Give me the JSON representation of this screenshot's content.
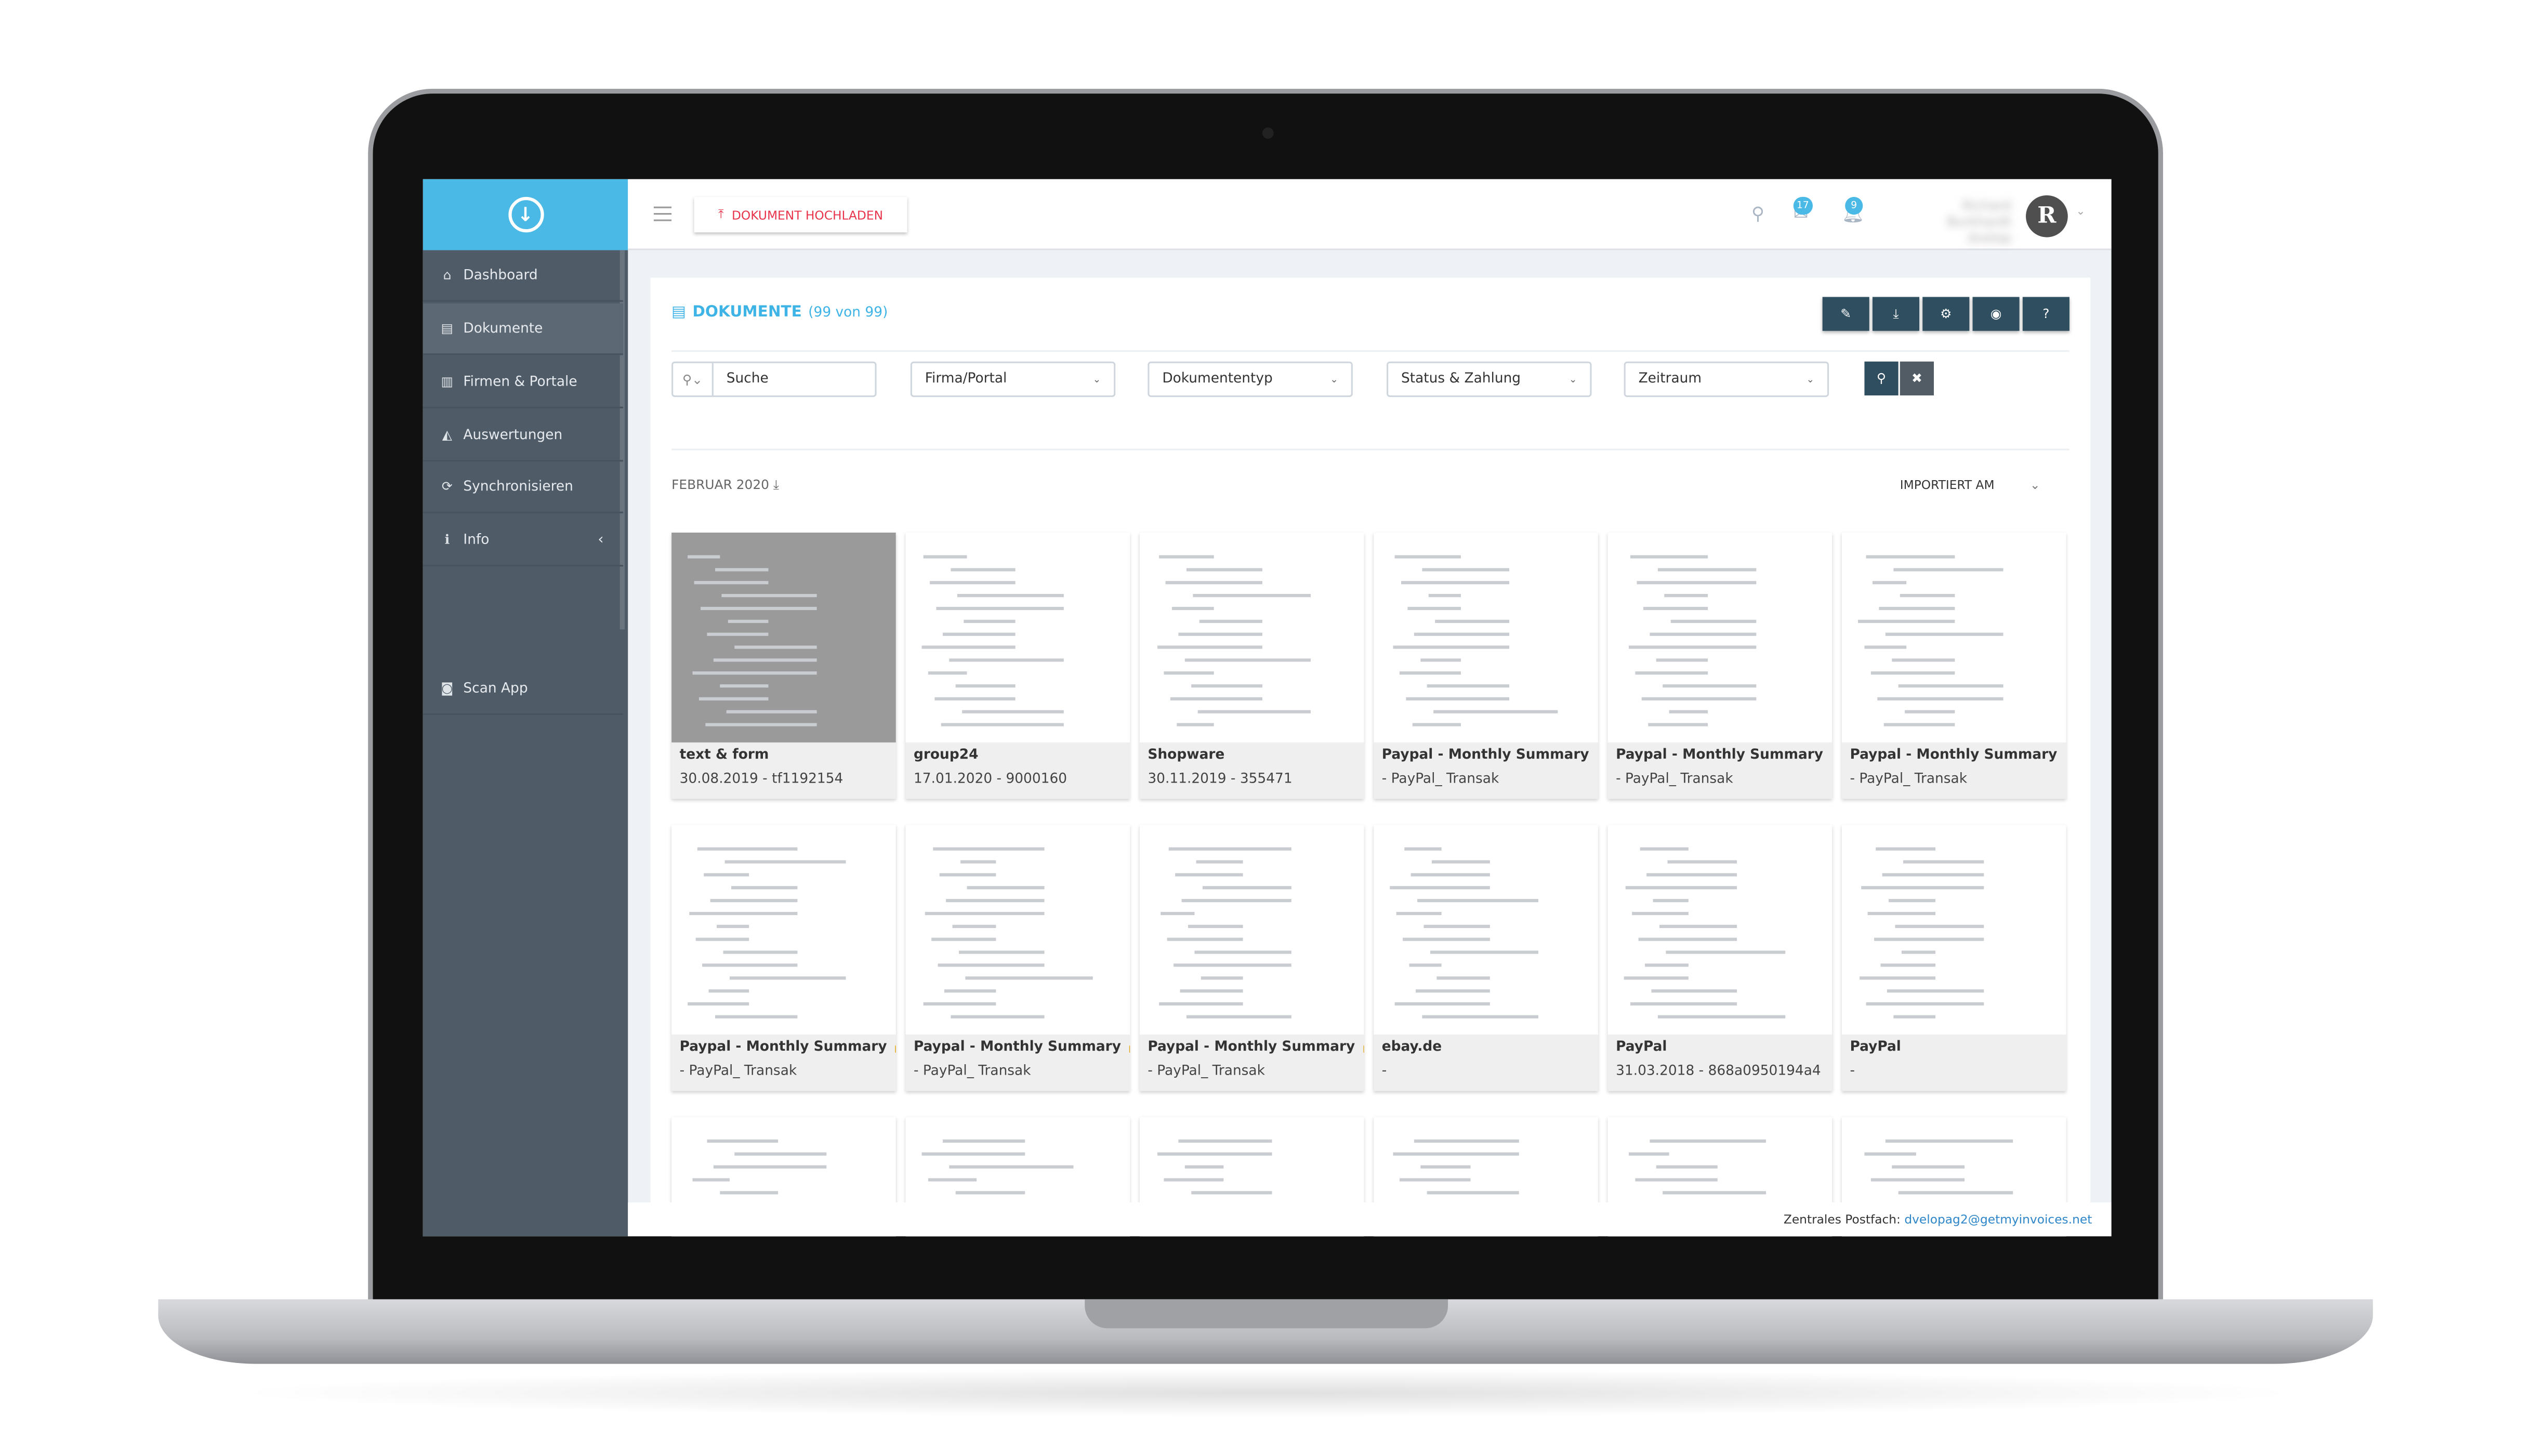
{
  "header": {
    "upload_label": "DOKUMENT HOCHLADEN",
    "mail_badge": "17",
    "bell_badge": "9",
    "user_name": "Richard Burkhardt",
    "user_role": "dvelop",
    "avatar_letter": "R"
  },
  "sidebar": {
    "items": [
      {
        "label": "Dashboard",
        "icon": "home-icon",
        "glyph": "⌂"
      },
      {
        "label": "Dokumente",
        "icon": "document-icon",
        "glyph": "▤",
        "active": true
      },
      {
        "label": "Firmen & Portale",
        "icon": "building-icon",
        "glyph": "▥"
      },
      {
        "label": "Auswertungen",
        "icon": "chart-icon",
        "glyph": "◭"
      },
      {
        "label": "Synchronisieren",
        "icon": "refresh-icon",
        "glyph": "⟳"
      },
      {
        "label": "Info",
        "icon": "info-icon",
        "glyph": "ℹ"
      },
      {
        "label": "Scan App",
        "icon": "camera-icon",
        "glyph": "◙"
      }
    ]
  },
  "main": {
    "title": "DOKUMENTE",
    "count": "(99 von 99)",
    "filters": {
      "search_placeholder": "Suche",
      "company": "Firma/Portal",
      "doctype": "Dokumententyp",
      "status": "Status & Zahlung",
      "period": "Zeitraum"
    },
    "group_label": "FEBRUAR 2020",
    "sort_label": "IMPORTIERT AM",
    "cards": [
      {
        "title": "text & form",
        "subtitle": "30.08.2019 - tf1192154"
      },
      {
        "title": "group24",
        "subtitle": "17.01.2020 - 9000160"
      },
      {
        "title": "Shopware",
        "subtitle": "30.11.2019 - 355471"
      },
      {
        "title": "Paypal - Monthly Summary",
        "subtitle": "- PayPal_ Transak"
      },
      {
        "title": "Paypal - Monthly Summary",
        "subtitle": "- PayPal_ Transak"
      },
      {
        "title": "Paypal - Monthly Summary",
        "subtitle": "- PayPal_ Transak"
      },
      {
        "title": "Paypal - Monthly Summary 🔒",
        "subtitle": "- PayPal_ Transak"
      },
      {
        "title": "Paypal - Monthly Summary 🔒",
        "subtitle": "- PayPal_ Transak"
      },
      {
        "title": "Paypal - Monthly Summary 🔒",
        "subtitle": "- PayPal_ Transak"
      },
      {
        "title": "ebay.de",
        "subtitle": "-"
      },
      {
        "title": "PayPal",
        "subtitle": "31.03.2018 - 868a0950194a4"
      },
      {
        "title": "PayPal",
        "subtitle": "-"
      },
      {
        "title": "",
        "subtitle": ""
      },
      {
        "title": "",
        "subtitle": ""
      },
      {
        "title": "",
        "subtitle": ""
      },
      {
        "title": "",
        "subtitle": ""
      },
      {
        "title": "",
        "subtitle": ""
      },
      {
        "title": "",
        "subtitle": ""
      }
    ]
  },
  "footer": {
    "label": "Zentrales Postfach:",
    "email": "dvelopag2@getmyinvoices.net"
  },
  "colors": {
    "accent": "#4ab9e6",
    "sidebar": "#4f5c68",
    "toolbar_button": "#2f4e60",
    "upload": "#e8324a"
  }
}
